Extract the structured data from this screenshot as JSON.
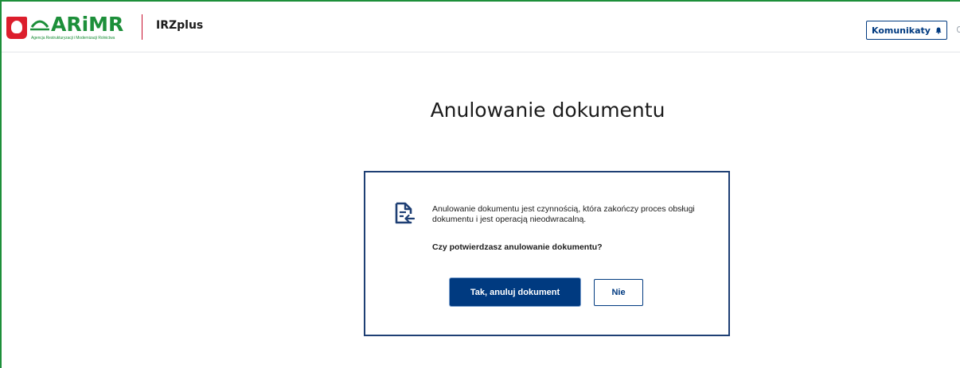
{
  "header": {
    "logo_text": "ARiMR",
    "logo_subtitle": "Agencja Restrukturyzacji i Modernizacji Rolnictwa",
    "app_name": "IRZplus",
    "notifications_label": "Komunikaty",
    "notifications_icon": "bell-icon"
  },
  "page": {
    "title": "Anulowanie dokumentu"
  },
  "dialog": {
    "icon": "document-return-icon",
    "message": "Anulowanie dokumentu jest czynnością, która zakończy proces obsługi dokumentu i jest operacją nieodwracalną.",
    "question": "Czy potwierdzasz anulowanie dokumentu?",
    "confirm_label": "Tak, anuluj dokument",
    "cancel_label": "Nie"
  },
  "colors": {
    "brand_green": "#1d8f3a",
    "primary_blue": "#003a80",
    "dialog_border": "#1e3f74",
    "divider_red": "#c8102e"
  }
}
